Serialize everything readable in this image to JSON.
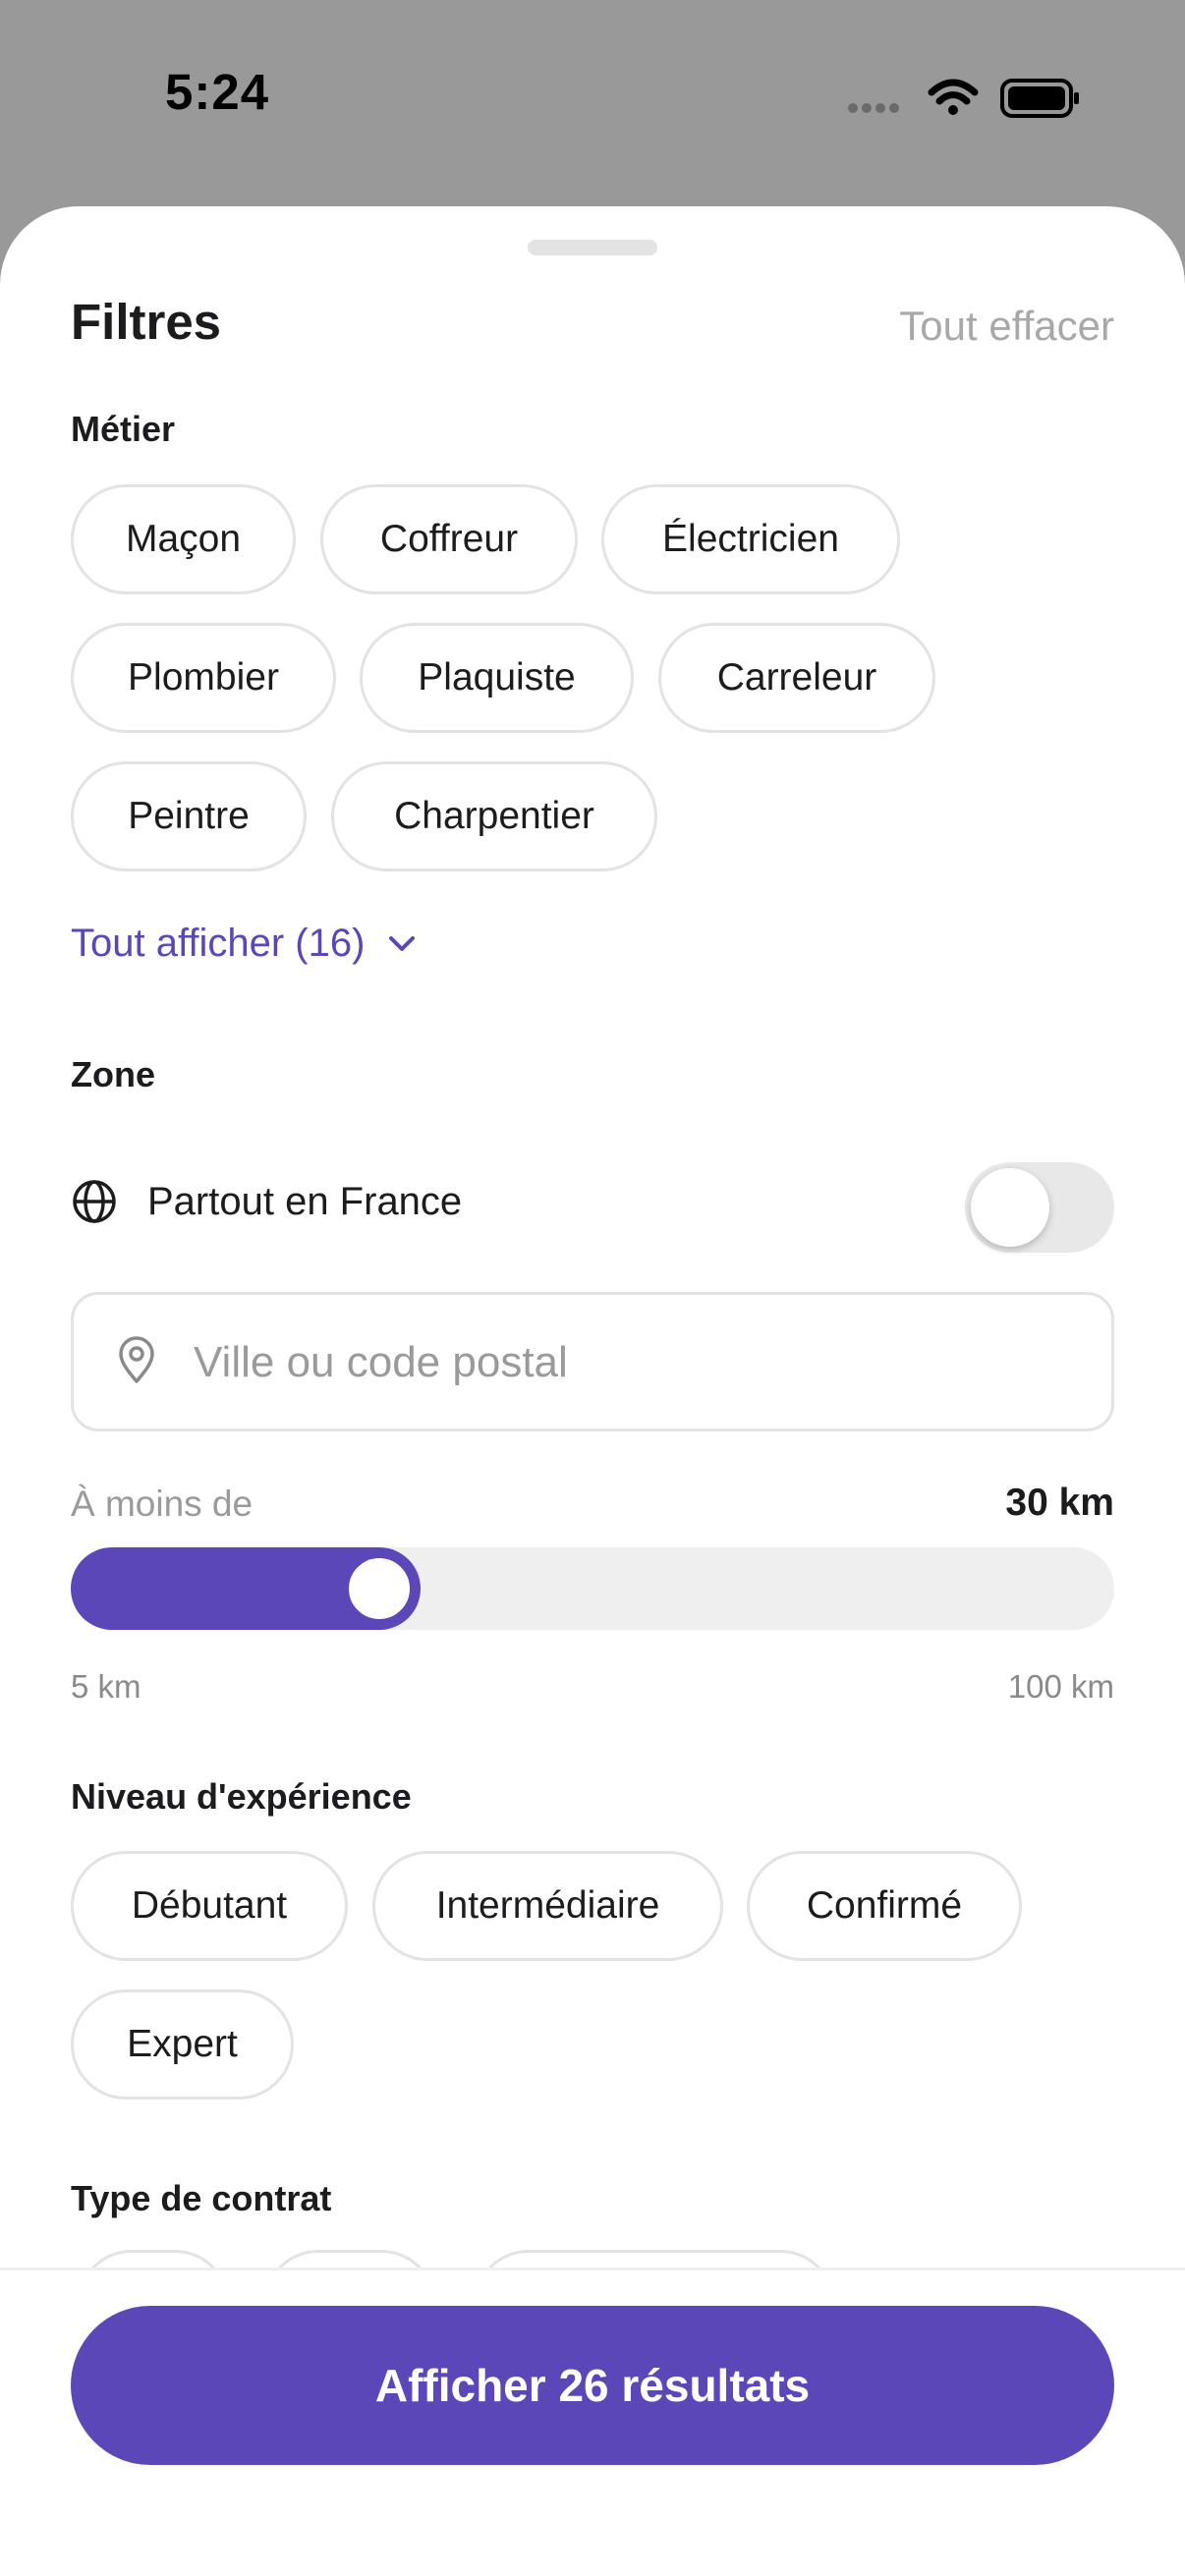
{
  "status_bar": {
    "time": "5:24"
  },
  "header": {
    "title": "Filtres",
    "clear_label": "Tout effacer"
  },
  "trade": {
    "label": "Métier",
    "chips": [
      "Maçon",
      "Coffreur",
      "Électricien",
      "Plombier",
      "Plaquiste",
      "Carreleur",
      "Peintre",
      "Charpentier"
    ],
    "show_all_label": "Tout afficher (16)"
  },
  "zone": {
    "label": "Zone",
    "everywhere_label": "Partout en France",
    "everywhere_enabled": false,
    "search_placeholder": "Ville ou code postal",
    "distance_label": "À moins de",
    "distance_value": "30 km",
    "distance_km": 30,
    "min_label": "5 km",
    "max_label": "100 km",
    "min_km": 5,
    "max_km": 100
  },
  "experience": {
    "label": "Niveau d'expérience",
    "chips": [
      "Débutant",
      "Intermédiaire",
      "Confirmé",
      "Expert"
    ]
  },
  "contract": {
    "label": "Type de contrat"
  },
  "footer": {
    "cta_label": "Afficher 26 résultats"
  },
  "colors": {
    "accent": "#5b47b8",
    "chip_border": "#e3e3e3",
    "muted_text": "#a8a8a8",
    "overlay": "#999999"
  }
}
